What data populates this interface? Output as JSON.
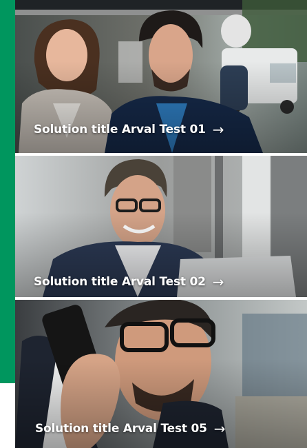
{
  "colors": {
    "accent": "#00965e",
    "label_text": "#ffffff"
  },
  "cards": [
    {
      "title": "Solution title Arval Test 01",
      "arrow": "→",
      "image": "two-people-looking-up-photo"
    },
    {
      "title": "Solution title Arval Test 02",
      "arrow": "→",
      "image": "man-with-glasses-at-laptop-photo"
    },
    {
      "title": "Solution title Arval Test 05",
      "arrow": "→",
      "image": "man-on-phone-photo"
    }
  ]
}
